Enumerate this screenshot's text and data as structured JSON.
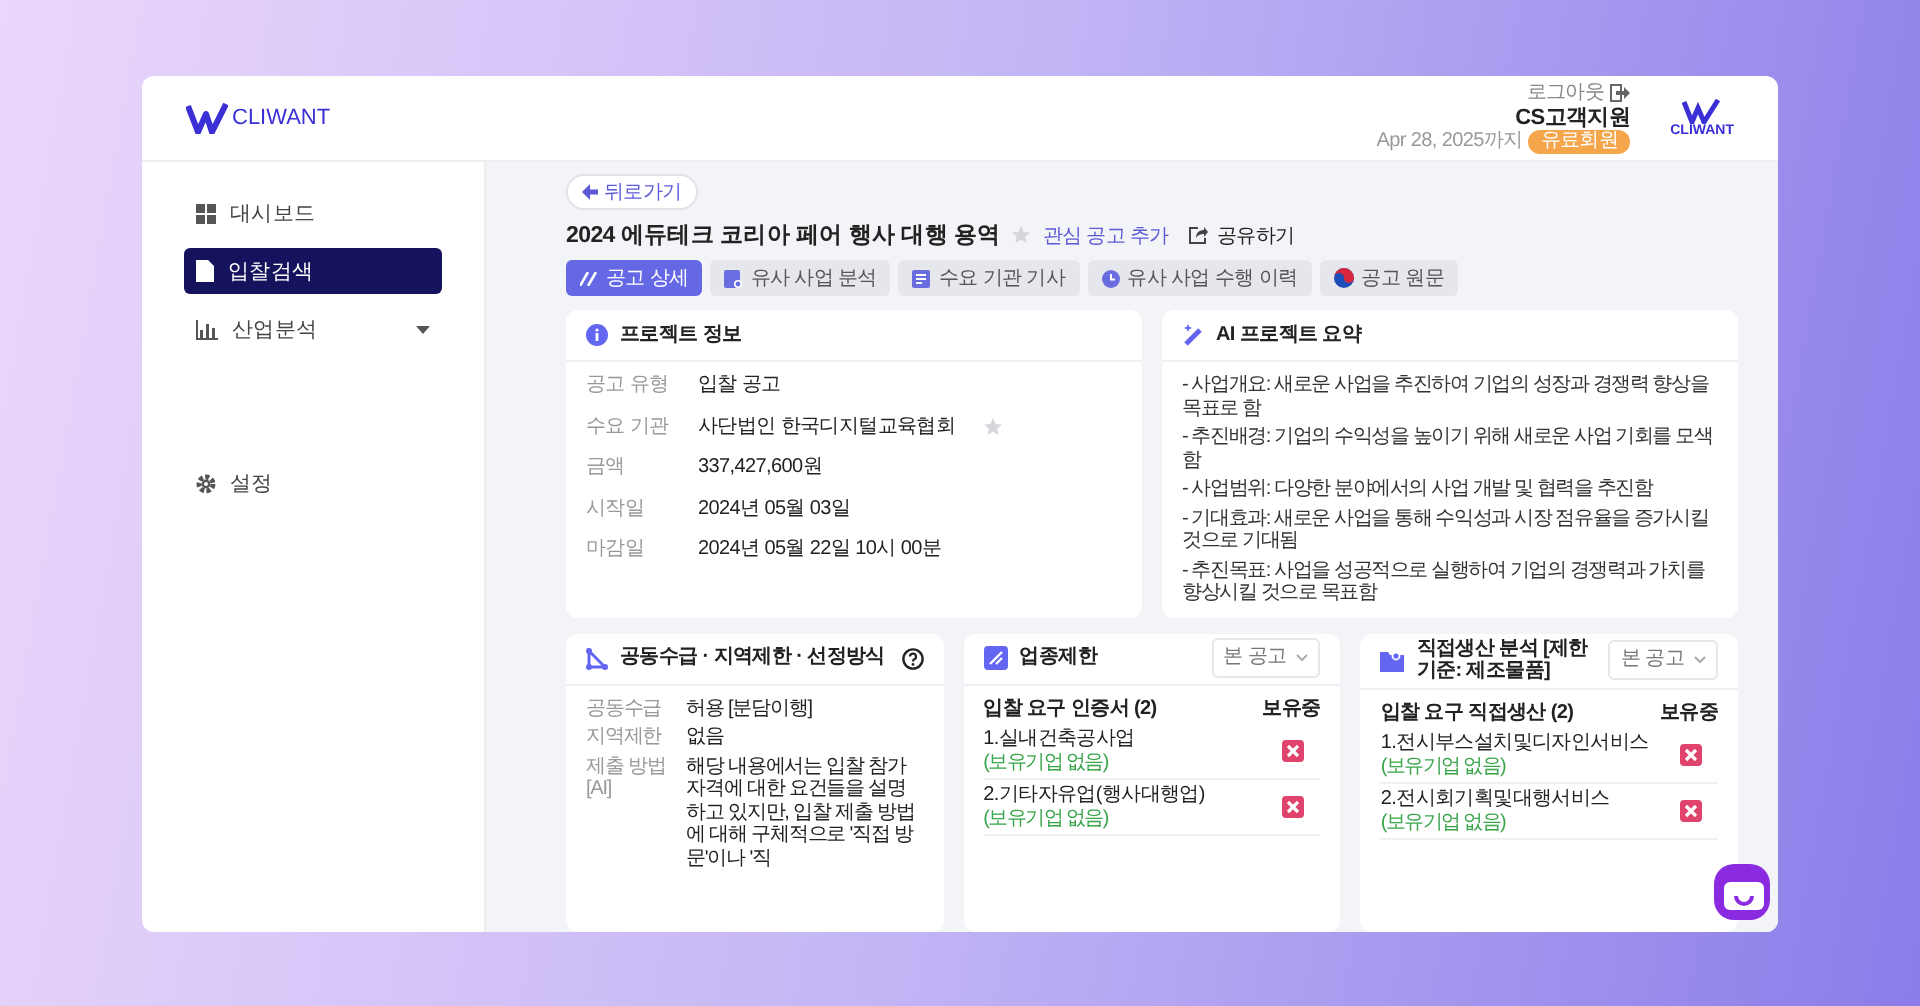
{
  "header": {
    "logo_text": "CLIWANT",
    "logout": "로그아웃",
    "user": "CS고객지원",
    "expiry": "Apr 28, 2025까지",
    "badge": "유료회원",
    "brand_text": "CLIWANT"
  },
  "sidebar": {
    "items": [
      {
        "kind": "dashboard",
        "label": "대시보드",
        "selected": false
      },
      {
        "kind": "search",
        "label": "입찰검색",
        "selected": true
      },
      {
        "kind": "analysis",
        "label": "산업분석",
        "selected": false,
        "expanded": false
      },
      {
        "kind": "settings",
        "label": "설정",
        "selected": false
      }
    ]
  },
  "back_button": "뒤로가기",
  "title": "2024 에듀테크 코리아 페어 행사 대행 용역",
  "favorite": {
    "label": "관심 공고 추가",
    "on": false
  },
  "share": "공유하기",
  "tabs": [
    {
      "kind": "detail",
      "label": "공고 상세",
      "selected": true
    },
    {
      "kind": "similar",
      "label": "유사 사업 분석",
      "selected": false
    },
    {
      "kind": "article",
      "label": "수요 기관 기사",
      "selected": false
    },
    {
      "kind": "history",
      "label": "유사 사업 수행 이력",
      "selected": false
    },
    {
      "kind": "original",
      "label": "공고 원문",
      "selected": false
    }
  ],
  "project_info": {
    "title": "프로젝트 정보",
    "rows": [
      {
        "label": "공고 유형",
        "value": "입찰 공고"
      },
      {
        "label": "수요 기관",
        "value": "사단법인 한국디지털교육협회",
        "starred": false
      },
      {
        "label": "금액",
        "value": "337,427,600원"
      },
      {
        "label": "시작일",
        "value": "2024년 05월 03일"
      },
      {
        "label": "마감일",
        "value": "2024년 05월 22일 10시 00분"
      }
    ]
  },
  "ai_summary": {
    "title": "AI 프로젝트 요약",
    "lines": [
      "- 사업개요: 새로운 사업을 추진하여 기업의 성장과 경쟁력 향상을 목표로 함",
      "- 추진배경: 기업의 수익성을 높이기 위해 새로운 사업 기회를 모색함",
      "- 사업범위: 다양한 분야에서의 사업 개발 및 협력을 추진함",
      "- 기대효과: 새로운 사업을 통해 수익성과 시장 점유율을 증가시킬 것으로 기대됨",
      "- 추진목표: 사업을 성공적으로 실행하여 기업의 경쟁력과 가치를 향상시킬 것으로 목표함"
    ]
  },
  "joint": {
    "title": "공동수급 · 지역제한 · 선정방식",
    "rows": [
      {
        "label": "공동수급",
        "value": "허용 [분담이행]"
      },
      {
        "label": "지역제한",
        "value": "없음"
      },
      {
        "label": "제출 방법 [AI]",
        "value": "해당 내용에서는 입찰 참가 자격에 대한 요건들을 설명하고 있지만, 입찰 제출 방법에 대해 구체적으로 '직접 방문'이나 '직"
      }
    ]
  },
  "industry": {
    "title": "업종제한",
    "filter": "본 공고",
    "list_title": "입찰 요구 인증서 (2)",
    "held_header": "보유중",
    "items": [
      {
        "name": "1.실내건축공사업",
        "note": "(보유기업 없음)",
        "held": false
      },
      {
        "name": "2.기타자유업(행사대행업)",
        "note": "(보유기업 없음)",
        "held": false
      }
    ]
  },
  "direct": {
    "title": "직접생산 분석 [제한 기준: 제조물품]",
    "filter": "본 공고",
    "list_title": "입찰 요구 직접생산 (2)",
    "held_header": "보유중",
    "items": [
      {
        "name": "1.전시부스설치및디자인서비스",
        "note": "(보유기업 없음)",
        "held": false
      },
      {
        "name": "2.전시회기획및대행서비스",
        "note": "(보유기업 없음)",
        "held": false
      }
    ]
  }
}
